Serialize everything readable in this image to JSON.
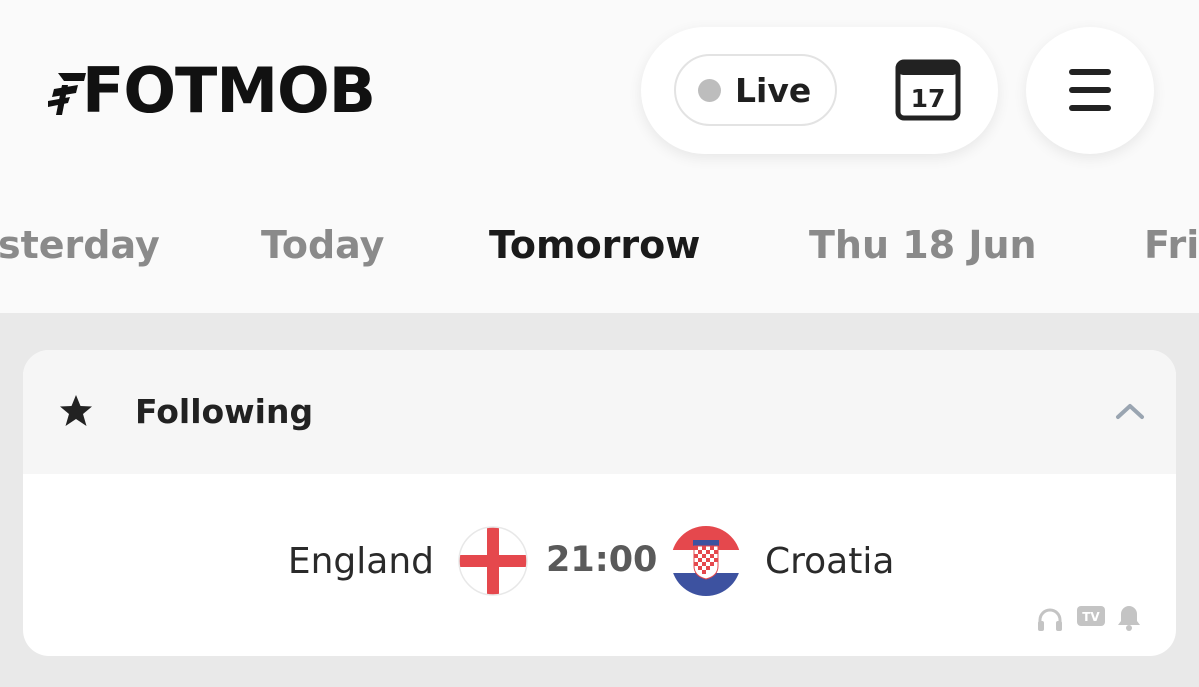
{
  "header": {
    "logo_text": "FOTMOB",
    "live_label": "Live",
    "calendar_day": "17"
  },
  "date_tabs": [
    {
      "label": "sterday",
      "active": false
    },
    {
      "label": "Today",
      "active": false
    },
    {
      "label": "Tomorrow",
      "active": true
    },
    {
      "label": "Thu 18 Jun",
      "active": false
    },
    {
      "label": "Fri",
      "active": false
    }
  ],
  "following": {
    "title": "Following",
    "match": {
      "home_team": "England",
      "time": "21:00",
      "away_team": "Croatia",
      "icons": [
        "headphones-icon",
        "tv-icon",
        "bell-icon"
      ]
    }
  },
  "colors": {
    "page_bg": "#e9e9e9",
    "header_bg": "#fafafa",
    "active_tab": "#1a1a1a",
    "inactive_tab": "#8a8a8a",
    "live_dot": "#bdbdbd"
  }
}
